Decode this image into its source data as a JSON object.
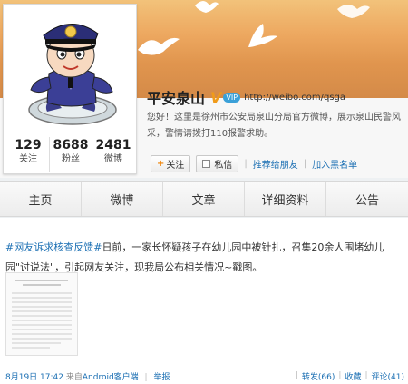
{
  "profile": {
    "name": "平安泉山",
    "verified_mark": "V",
    "vip_badge": "VIP",
    "url": "http://weibo.com/qsga",
    "intro": "您好！这里是徐州市公安局泉山分局官方微博，展示泉山民警风采，警情请拨打110报警求助。",
    "stats": [
      {
        "value": "129",
        "label": "关注"
      },
      {
        "value": "8688",
        "label": "粉丝"
      },
      {
        "value": "2481",
        "label": "微博"
      }
    ]
  },
  "actions": {
    "follow_label": "关注",
    "message_label": "私信",
    "recommend_label": "推荐给朋友",
    "blacklist_label": "加入黑名单"
  },
  "tabs": [
    "主页",
    "微博",
    "文章",
    "详细资料",
    "公告"
  ],
  "post": {
    "hashtag": "#网友诉求核查反馈#",
    "text": "日前，一家长怀疑孩子在幼儿园中被针扎，召集20余人围堵幼儿园\"讨说法\"，引起网友关注，现我局公布相关情况~戳图。",
    "date": "8月19日 17:42",
    "source_prefix": "来自",
    "source": "Android客户端",
    "report": "举报",
    "repost": "转发(66)",
    "favorite": "收藏",
    "comment": "评论(41)"
  },
  "colors": {
    "link": "#1b6fb3",
    "banner": "#e0954e",
    "accent": "#f08000"
  }
}
